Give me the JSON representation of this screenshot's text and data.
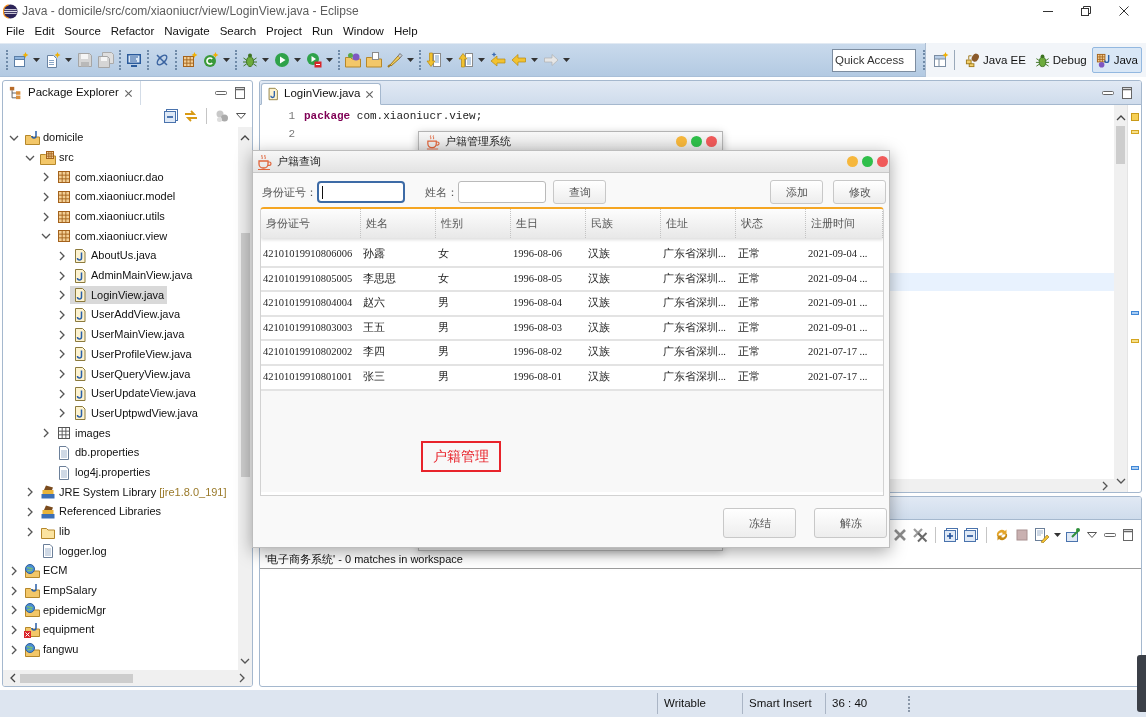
{
  "window": {
    "title": "Java - domicile/src/com/xiaoniucr/view/LoginView.java - Eclipse"
  },
  "menu_bar": [
    "File",
    "Edit",
    "Source",
    "Refactor",
    "Navigate",
    "Search",
    "Project",
    "Run",
    "Window",
    "Help"
  ],
  "toolbar": {
    "quick_access": {
      "placeholder": "Quick Access"
    },
    "perspectives": [
      {
        "label": "Java EE",
        "kind": "javaee",
        "selected": false
      },
      {
        "label": "Debug",
        "kind": "debug",
        "selected": false
      },
      {
        "label": "Java",
        "kind": "java",
        "selected": true
      }
    ]
  },
  "package_explorer": {
    "title": "Package Explorer",
    "tree": [
      {
        "label": "domicile",
        "kind": "java-project",
        "expanded": true,
        "selected": false,
        "children": [
          {
            "label": "src",
            "kind": "source-folder",
            "expanded": true,
            "selected": false,
            "children": [
              {
                "label": "com.xiaoniucr.dao",
                "kind": "package",
                "expanded": false,
                "selected": false
              },
              {
                "label": "com.xiaoniucr.model",
                "kind": "package",
                "expanded": false,
                "selected": false
              },
              {
                "label": "com.xiaoniucr.utils",
                "kind": "package",
                "expanded": false,
                "selected": false
              },
              {
                "label": "com.xiaoniucr.view",
                "kind": "package",
                "expanded": true,
                "selected": false,
                "children": [
                  {
                    "label": "AboutUs.java",
                    "kind": "java-file",
                    "expanded": false,
                    "selected": false
                  },
                  {
                    "label": "AdminMainView.java",
                    "kind": "java-file",
                    "expanded": false,
                    "selected": false
                  },
                  {
                    "label": "LoginView.java",
                    "kind": "java-file",
                    "expanded": false,
                    "selected": true
                  },
                  {
                    "label": "UserAddView.java",
                    "kind": "java-file",
                    "expanded": false,
                    "selected": false
                  },
                  {
                    "label": "UserMainView.java",
                    "kind": "java-file",
                    "expanded": false,
                    "selected": false
                  },
                  {
                    "label": "UserProfileView.java",
                    "kind": "java-file",
                    "expanded": false,
                    "selected": false
                  },
                  {
                    "label": "UserQueryView.java",
                    "kind": "java-file",
                    "expanded": false,
                    "selected": false
                  },
                  {
                    "label": "UserUpdateView.java",
                    "kind": "java-file",
                    "expanded": false,
                    "selected": false
                  },
                  {
                    "label": "UserUptpwdView.java",
                    "kind": "java-file",
                    "expanded": false,
                    "selected": false
                  }
                ]
              },
              {
                "label": "images",
                "kind": "empty-package",
                "expanded": false,
                "selected": false
              },
              {
                "label": "db.properties",
                "kind": "file",
                "selected": false
              },
              {
                "label": "log4j.properties",
                "kind": "file",
                "selected": false
              }
            ]
          },
          {
            "label": "JRE System Library",
            "decoration": "[jre1.8.0_191]",
            "kind": "library",
            "expanded": false,
            "selected": false
          },
          {
            "label": "Referenced Libraries",
            "kind": "library",
            "expanded": false,
            "selected": false
          },
          {
            "label": "lib",
            "kind": "folder",
            "expanded": false,
            "selected": false
          },
          {
            "label": "logger.log",
            "kind": "file",
            "selected": false
          }
        ]
      },
      {
        "label": "ECM",
        "kind": "web-project",
        "expanded": false,
        "selected": false
      },
      {
        "label": "EmpSalary",
        "kind": "java-project",
        "expanded": false,
        "selected": false
      },
      {
        "label": "epidemicMgr",
        "kind": "web-project",
        "expanded": false,
        "selected": false
      },
      {
        "label": "equipment",
        "kind": "java-project",
        "error": true,
        "expanded": false,
        "selected": false
      },
      {
        "label": "fangwu",
        "kind": "web-project",
        "expanded": false,
        "selected": false
      }
    ]
  },
  "editor": {
    "tabs": [
      {
        "label": "LoginView.java",
        "selected": true
      }
    ],
    "lines": [
      {
        "number": "1",
        "code": "**package** com.xiaoniucr.view;"
      },
      {
        "number": "2"
      }
    ]
  },
  "search_view": {
    "summary": "'电子商务系统' - 0 matches in workspace"
  },
  "status_bar": [
    "Writable",
    "Smart Insert",
    "36 : 40"
  ],
  "background_window": {
    "title": "户籍管理系统"
  },
  "dialog": {
    "title": "户籍查询",
    "fields": [
      {
        "label": "身份证号：",
        "focused": true
      },
      {
        "label": "姓名：",
        "focused": false
      }
    ],
    "search_button": "查询",
    "actions": [
      "添加",
      "修改"
    ],
    "table": {
      "columns": [
        "身份证号",
        "姓名",
        "性别",
        "生日",
        "民族",
        "住址",
        "状态",
        "注册时间"
      ],
      "rows": [
        [
          "42101019910806006",
          "孙露",
          "女",
          "1996-08-06",
          "汉族",
          "广东省深圳...",
          "正常",
          "2021-09-04 ..."
        ],
        [
          "42101019910805005",
          "李思思",
          "女",
          "1996-08-05",
          "汉族",
          "广东省深圳...",
          "正常",
          "2021-09-04 ..."
        ],
        [
          "42101019910804004",
          "赵六",
          "男",
          "1996-08-04",
          "汉族",
          "广东省深圳...",
          "正常",
          "2021-09-01 ..."
        ],
        [
          "42101019910803003",
          "王五",
          "男",
          "1996-08-03",
          "汉族",
          "广东省深圳...",
          "正常",
          "2021-09-01 ..."
        ],
        [
          "42101019910802002",
          "李四",
          "男",
          "1996-08-02",
          "汉族",
          "广东省深圳...",
          "正常",
          "2021-07-17 ..."
        ],
        [
          "42101019910801001",
          "张三",
          "男",
          "1996-08-01",
          "汉族",
          "广东省深圳...",
          "正常",
          "2021-07-17 ..."
        ]
      ]
    },
    "stamp": "户籍管理",
    "footer_buttons": [
      "冻结",
      "解冻"
    ]
  }
}
